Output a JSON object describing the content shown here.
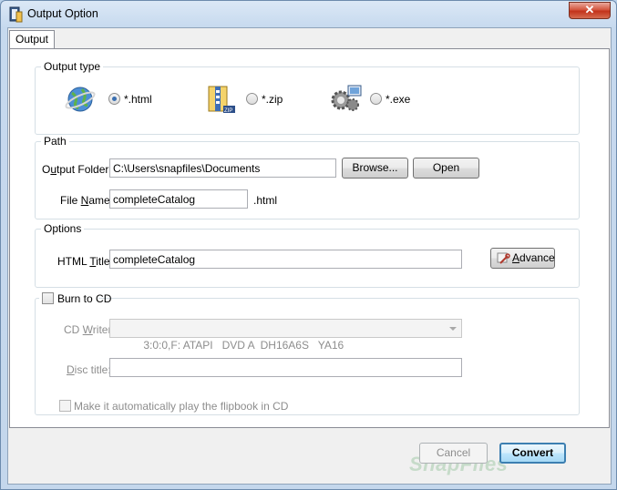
{
  "window": {
    "title": "Output Option",
    "close_glyph": "✕"
  },
  "tabs": [
    {
      "label": "Output"
    }
  ],
  "output_type": {
    "group_title": "Output type",
    "options": [
      {
        "label": "*.html",
        "icon": "globe-icon",
        "selected": true
      },
      {
        "label": "*.zip",
        "icon": "zip-archive-icon",
        "selected": false
      },
      {
        "label": "*.exe",
        "icon": "gears-computer-icon",
        "selected": false
      }
    ]
  },
  "path": {
    "group_title": "Path",
    "output_folder_label_pre": "O",
    "output_folder_label_u": "u",
    "output_folder_label_post": "tput Folder:",
    "output_folder_value": "C:\\Users\\snapfiles\\Documents",
    "browse_label": "Browse...",
    "open_label": "Open",
    "file_name_label_pre": "File ",
    "file_name_label_u": "N",
    "file_name_label_post": "ame:",
    "file_name_value": "completeCatalog",
    "extension": ".html"
  },
  "options": {
    "group_title": "Options",
    "html_title_label_pre": "HTML ",
    "html_title_label_u": "T",
    "html_title_label_post": "itle:",
    "html_title_value": "completeCatalog",
    "advance_label_u": "A",
    "advance_label_post": "dvance"
  },
  "burn": {
    "checkbox_label": "Burn to CD",
    "checked": false,
    "cd_writer_label_pre": "CD ",
    "cd_writer_label_u": "W",
    "cd_writer_label_post": "riter",
    "cd_writer_value": "3:0:0,F: ATAPI   DVD A  DH16A6S   YA16",
    "disc_title_label_u": "D",
    "disc_title_label_post": "isc title:",
    "disc_title_value": "",
    "autoplay_label": "Make it automatically play the flipbook in CD"
  },
  "footer": {
    "cancel_label": "Cancel",
    "convert_label": "Convert",
    "watermark": "SnapFiles"
  },
  "colors": {
    "title_bar": "#c6d9ee",
    "close_button": "#c2331b",
    "selected_radio": "#3a6fb0",
    "convert_border": "#3c7fb1"
  }
}
